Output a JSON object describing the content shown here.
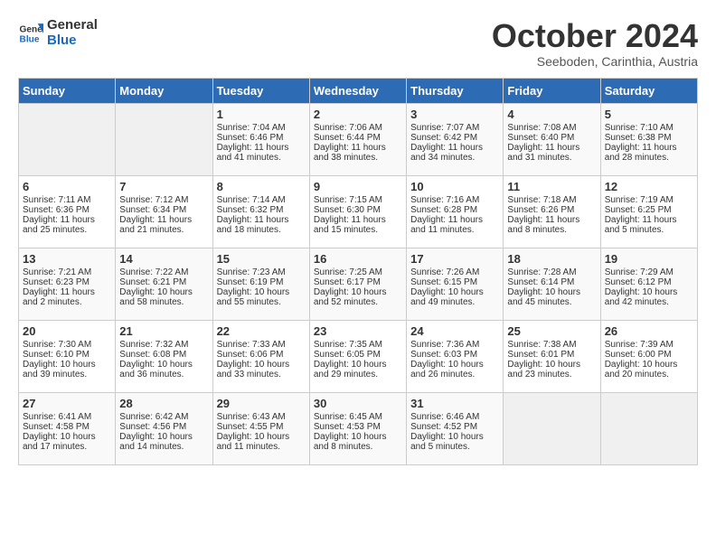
{
  "header": {
    "logo_line1": "General",
    "logo_line2": "Blue",
    "month": "October 2024",
    "location": "Seeboden, Carinthia, Austria"
  },
  "days_of_week": [
    "Sunday",
    "Monday",
    "Tuesday",
    "Wednesday",
    "Thursday",
    "Friday",
    "Saturday"
  ],
  "weeks": [
    [
      {
        "day": "",
        "empty": true
      },
      {
        "day": "",
        "empty": true
      },
      {
        "day": "1",
        "sunrise": "Sunrise: 7:04 AM",
        "sunset": "Sunset: 6:46 PM",
        "daylight": "Daylight: 11 hours and 41 minutes."
      },
      {
        "day": "2",
        "sunrise": "Sunrise: 7:06 AM",
        "sunset": "Sunset: 6:44 PM",
        "daylight": "Daylight: 11 hours and 38 minutes."
      },
      {
        "day": "3",
        "sunrise": "Sunrise: 7:07 AM",
        "sunset": "Sunset: 6:42 PM",
        "daylight": "Daylight: 11 hours and 34 minutes."
      },
      {
        "day": "4",
        "sunrise": "Sunrise: 7:08 AM",
        "sunset": "Sunset: 6:40 PM",
        "daylight": "Daylight: 11 hours and 31 minutes."
      },
      {
        "day": "5",
        "sunrise": "Sunrise: 7:10 AM",
        "sunset": "Sunset: 6:38 PM",
        "daylight": "Daylight: 11 hours and 28 minutes."
      }
    ],
    [
      {
        "day": "6",
        "sunrise": "Sunrise: 7:11 AM",
        "sunset": "Sunset: 6:36 PM",
        "daylight": "Daylight: 11 hours and 25 minutes."
      },
      {
        "day": "7",
        "sunrise": "Sunrise: 7:12 AM",
        "sunset": "Sunset: 6:34 PM",
        "daylight": "Daylight: 11 hours and 21 minutes."
      },
      {
        "day": "8",
        "sunrise": "Sunrise: 7:14 AM",
        "sunset": "Sunset: 6:32 PM",
        "daylight": "Daylight: 11 hours and 18 minutes."
      },
      {
        "day": "9",
        "sunrise": "Sunrise: 7:15 AM",
        "sunset": "Sunset: 6:30 PM",
        "daylight": "Daylight: 11 hours and 15 minutes."
      },
      {
        "day": "10",
        "sunrise": "Sunrise: 7:16 AM",
        "sunset": "Sunset: 6:28 PM",
        "daylight": "Daylight: 11 hours and 11 minutes."
      },
      {
        "day": "11",
        "sunrise": "Sunrise: 7:18 AM",
        "sunset": "Sunset: 6:26 PM",
        "daylight": "Daylight: 11 hours and 8 minutes."
      },
      {
        "day": "12",
        "sunrise": "Sunrise: 7:19 AM",
        "sunset": "Sunset: 6:25 PM",
        "daylight": "Daylight: 11 hours and 5 minutes."
      }
    ],
    [
      {
        "day": "13",
        "sunrise": "Sunrise: 7:21 AM",
        "sunset": "Sunset: 6:23 PM",
        "daylight": "Daylight: 11 hours and 2 minutes."
      },
      {
        "day": "14",
        "sunrise": "Sunrise: 7:22 AM",
        "sunset": "Sunset: 6:21 PM",
        "daylight": "Daylight: 10 hours and 58 minutes."
      },
      {
        "day": "15",
        "sunrise": "Sunrise: 7:23 AM",
        "sunset": "Sunset: 6:19 PM",
        "daylight": "Daylight: 10 hours and 55 minutes."
      },
      {
        "day": "16",
        "sunrise": "Sunrise: 7:25 AM",
        "sunset": "Sunset: 6:17 PM",
        "daylight": "Daylight: 10 hours and 52 minutes."
      },
      {
        "day": "17",
        "sunrise": "Sunrise: 7:26 AM",
        "sunset": "Sunset: 6:15 PM",
        "daylight": "Daylight: 10 hours and 49 minutes."
      },
      {
        "day": "18",
        "sunrise": "Sunrise: 7:28 AM",
        "sunset": "Sunset: 6:14 PM",
        "daylight": "Daylight: 10 hours and 45 minutes."
      },
      {
        "day": "19",
        "sunrise": "Sunrise: 7:29 AM",
        "sunset": "Sunset: 6:12 PM",
        "daylight": "Daylight: 10 hours and 42 minutes."
      }
    ],
    [
      {
        "day": "20",
        "sunrise": "Sunrise: 7:30 AM",
        "sunset": "Sunset: 6:10 PM",
        "daylight": "Daylight: 10 hours and 39 minutes."
      },
      {
        "day": "21",
        "sunrise": "Sunrise: 7:32 AM",
        "sunset": "Sunset: 6:08 PM",
        "daylight": "Daylight: 10 hours and 36 minutes."
      },
      {
        "day": "22",
        "sunrise": "Sunrise: 7:33 AM",
        "sunset": "Sunset: 6:06 PM",
        "daylight": "Daylight: 10 hours and 33 minutes."
      },
      {
        "day": "23",
        "sunrise": "Sunrise: 7:35 AM",
        "sunset": "Sunset: 6:05 PM",
        "daylight": "Daylight: 10 hours and 29 minutes."
      },
      {
        "day": "24",
        "sunrise": "Sunrise: 7:36 AM",
        "sunset": "Sunset: 6:03 PM",
        "daylight": "Daylight: 10 hours and 26 minutes."
      },
      {
        "day": "25",
        "sunrise": "Sunrise: 7:38 AM",
        "sunset": "Sunset: 6:01 PM",
        "daylight": "Daylight: 10 hours and 23 minutes."
      },
      {
        "day": "26",
        "sunrise": "Sunrise: 7:39 AM",
        "sunset": "Sunset: 6:00 PM",
        "daylight": "Daylight: 10 hours and 20 minutes."
      }
    ],
    [
      {
        "day": "27",
        "sunrise": "Sunrise: 6:41 AM",
        "sunset": "Sunset: 4:58 PM",
        "daylight": "Daylight: 10 hours and 17 minutes."
      },
      {
        "day": "28",
        "sunrise": "Sunrise: 6:42 AM",
        "sunset": "Sunset: 4:56 PM",
        "daylight": "Daylight: 10 hours and 14 minutes."
      },
      {
        "day": "29",
        "sunrise": "Sunrise: 6:43 AM",
        "sunset": "Sunset: 4:55 PM",
        "daylight": "Daylight: 10 hours and 11 minutes."
      },
      {
        "day": "30",
        "sunrise": "Sunrise: 6:45 AM",
        "sunset": "Sunset: 4:53 PM",
        "daylight": "Daylight: 10 hours and 8 minutes."
      },
      {
        "day": "31",
        "sunrise": "Sunrise: 6:46 AM",
        "sunset": "Sunset: 4:52 PM",
        "daylight": "Daylight: 10 hours and 5 minutes."
      },
      {
        "day": "",
        "empty": true
      },
      {
        "day": "",
        "empty": true
      }
    ]
  ]
}
